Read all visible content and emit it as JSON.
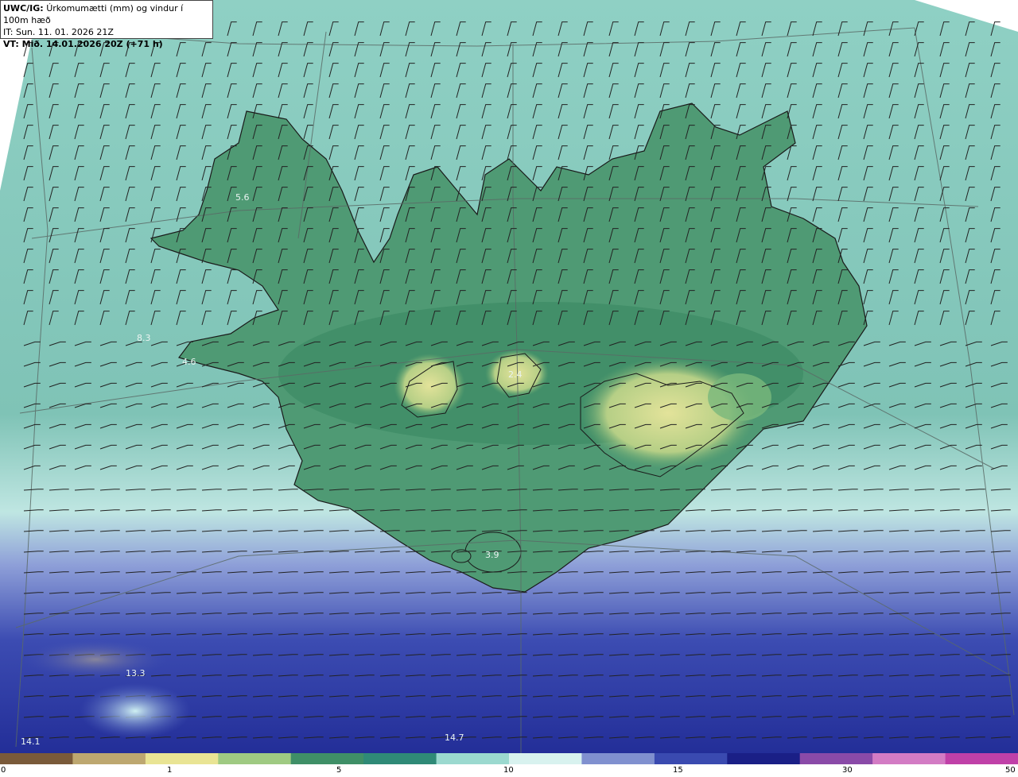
{
  "header": {
    "model": "UWC/IG:",
    "title": "Úrkomumætti (mm) og vindur í 100m hæð",
    "init_time": "IT: Sun. 11. 01. 2026 21Z",
    "valid_time": "VT: Mið. 14.01.2026 20Z (+71 h)"
  },
  "map_labels": [
    "5.6",
    "8.3",
    "4.6",
    "2.4",
    "3.9",
    "13.3",
    "14.7",
    "14.1"
  ],
  "colorbar": {
    "ticks": [
      "0",
      "1",
      "5",
      "10",
      "15",
      "30",
      "50"
    ],
    "colors": [
      "#7a5a3a",
      "#bda770",
      "#e9e494",
      "#9fca82",
      "#3f8f67",
      "#2f8a77",
      "#9bd9cf",
      "#d8f2ef",
      "#8090cf",
      "#3a4ab0",
      "#1a1f86",
      "#8a4aa8",
      "#d37bc4",
      "#c040a8"
    ]
  },
  "colors": {
    "sea_north": "#89cbc1",
    "land_green": "#3f8f67",
    "glacier_yellow": "#d9dd8c",
    "sea_south_blue": "#2e3aa2",
    "coast": "#1a1a1a"
  }
}
